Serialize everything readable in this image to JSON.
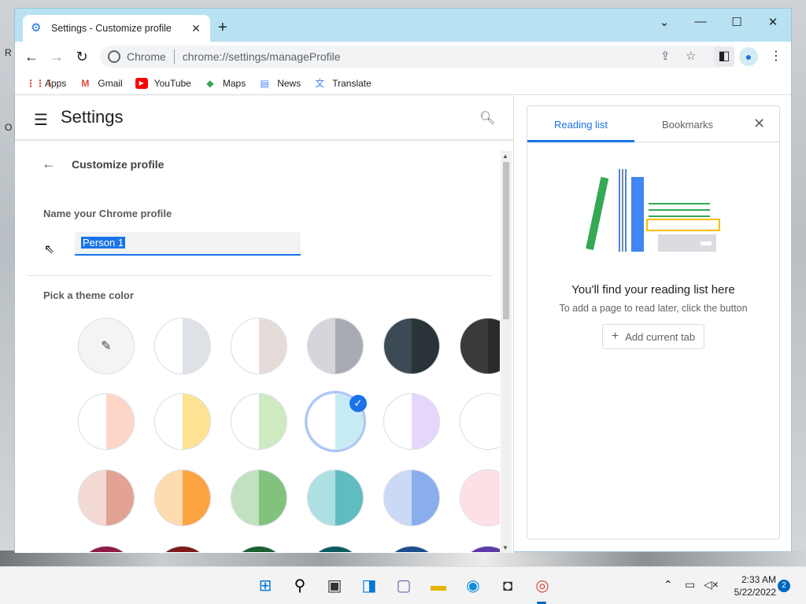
{
  "browser": {
    "tab_title": "Settings - Customize profile",
    "omnibox_site": "Chrome",
    "omnibox_url": "chrome://settings/manageProfile"
  },
  "bookmarks": [
    "Apps",
    "Gmail",
    "YouTube",
    "Maps",
    "News",
    "Translate"
  ],
  "settings": {
    "title": "Settings",
    "subpage_title": "Customize profile",
    "name_label": "Name your Chrome profile",
    "name_value": "Person 1",
    "theme_label": "Pick a theme color"
  },
  "theme_colors": [
    [
      [
        "#f3f4f5",
        "#f3f4f5",
        "custom"
      ],
      [
        "#ffffff",
        "#dee1e6"
      ],
      [
        "#ffffff",
        "#e5dcda"
      ],
      [
        "#d4d6dc",
        "#a9abb3"
      ],
      [
        "#3c4a55",
        "#2a3338"
      ],
      [
        "#3a3a3a",
        "#2b2b2b"
      ]
    ],
    [
      [
        "#ffffff",
        "#fdd6c8"
      ],
      [
        "#ffffff",
        "#fde293"
      ],
      [
        "#ffffff",
        "#cdeac0"
      ],
      [
        "#ffffff",
        "#c6ebf4"
      ],
      [
        "#ffffff",
        "#e5d7fb"
      ],
      [
        "#ffffff",
        "#ffffff"
      ]
    ],
    [
      [
        "#f3d9d4",
        "#e2a294"
      ],
      [
        "#fedbae",
        "#fba341"
      ],
      [
        "#c1e1c0",
        "#81c37d"
      ],
      [
        "#ace0e3",
        "#5fbcc1"
      ],
      [
        "#cad9f6",
        "#89aded"
      ],
      [
        "#fde0e5",
        "#fde0e5"
      ]
    ],
    [
      [
        "#8e1a47",
        "#8e1a47"
      ],
      [
        "#7c1a1a",
        "#7c1a1a"
      ],
      [
        "#1b5e31",
        "#1b5e31"
      ],
      [
        "#0b5b61",
        "#0b5b61"
      ],
      [
        "#1b4e8c",
        "#1b4e8c"
      ],
      [
        "#5e3aa8",
        "#5e3aa8"
      ]
    ]
  ],
  "selected_theme": "1-3",
  "side_panel": {
    "tab_reading": "Reading list",
    "tab_bookmarks": "Bookmarks",
    "headline": "You'll find your reading list here",
    "description": "To add a page to read later, click the button",
    "add_button": "Add current tab"
  },
  "taskbar": {
    "time": "2:33 AM",
    "date": "5/22/2022",
    "notifications": "2"
  },
  "colors": {
    "accent": "#1a73e8",
    "titlebar": "#b8e2f2"
  }
}
